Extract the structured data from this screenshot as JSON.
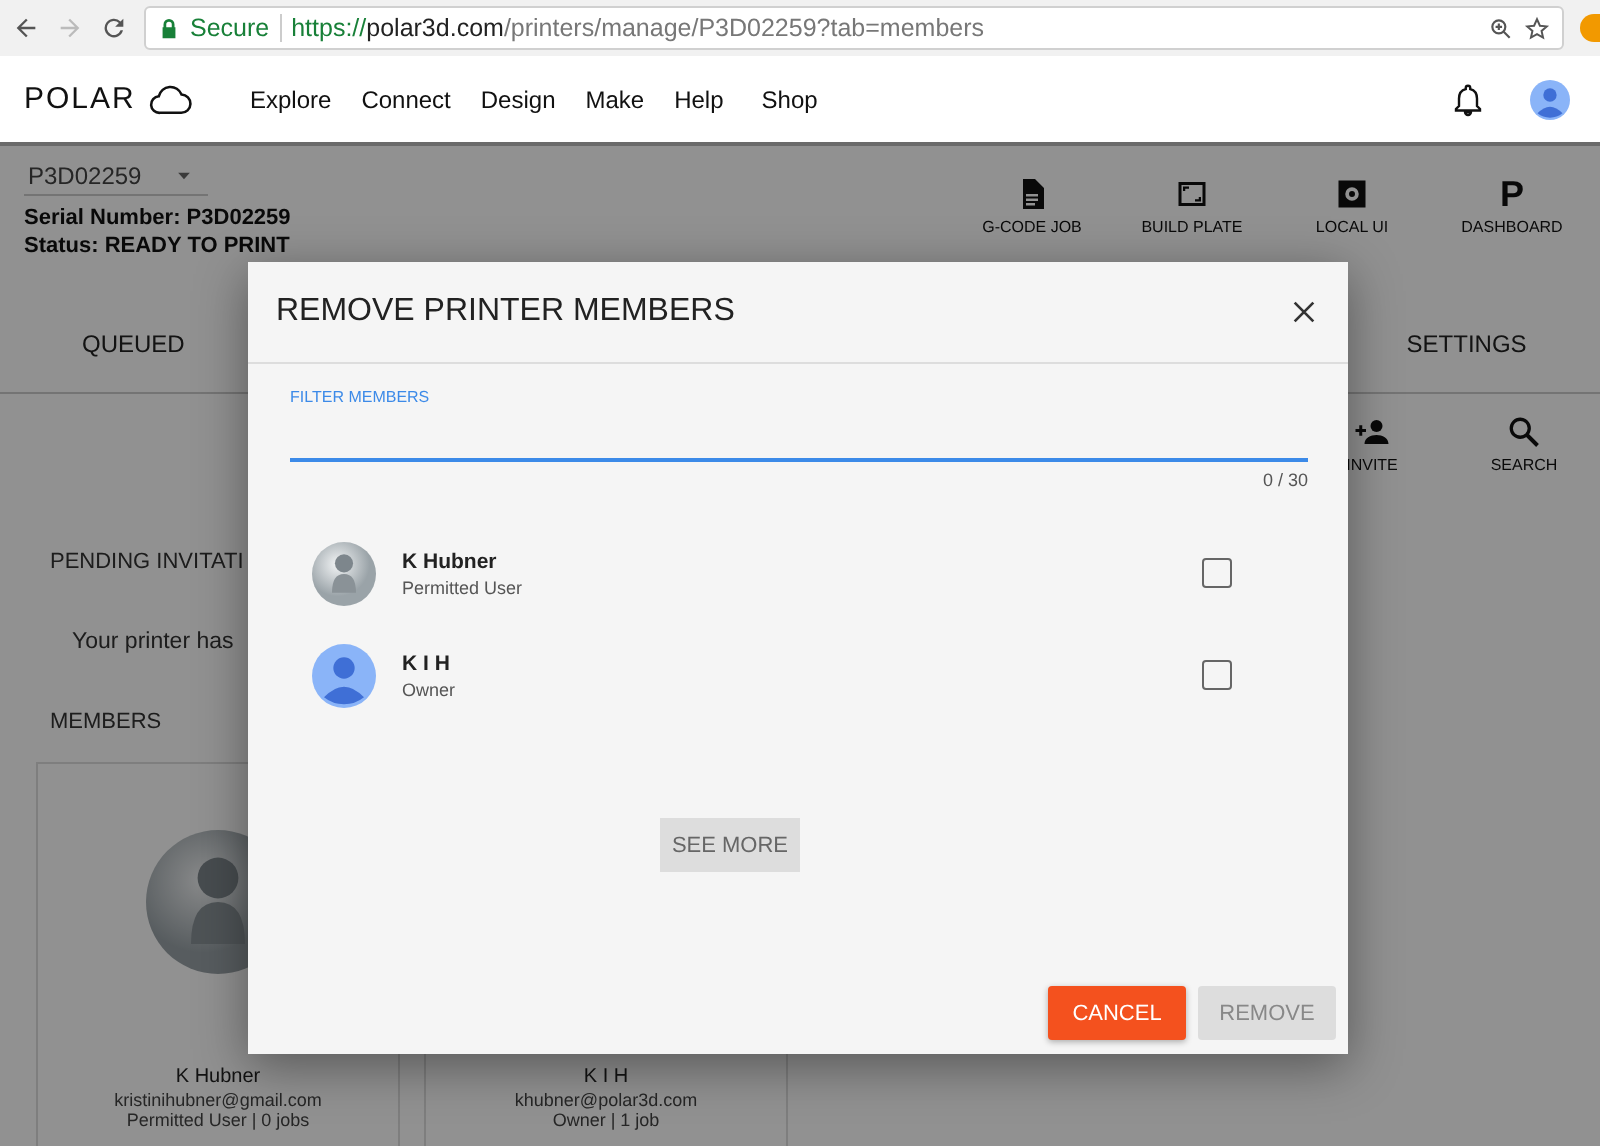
{
  "browser": {
    "security": "Secure",
    "url": {
      "scheme": "https://",
      "host": "polar3d.com",
      "path": "/printers/manage/P3D02259?tab=members"
    }
  },
  "nav": {
    "logo": "POLAR",
    "links": [
      "Explore",
      "Connect",
      "Design",
      "Make",
      "Help",
      "Shop"
    ]
  },
  "printer": {
    "selector": "P3D02259",
    "serial": "Serial Number: P3D02259",
    "status": "Status: READY TO PRINT"
  },
  "actions": [
    {
      "kind": "document",
      "label": "G-CODE JOB"
    },
    {
      "kind": "frame",
      "label": "BUILD PLATE"
    },
    {
      "kind": "chip",
      "label": "LOCAL UI"
    },
    {
      "kind": "letter",
      "glyph": "P",
      "label": "DASHBOARD"
    }
  ],
  "tabs": [
    {
      "label": "QUEUED"
    },
    {
      "label": "SETTINGS"
    }
  ],
  "toolbar": [
    {
      "kind": "invite",
      "label": "INVITE"
    },
    {
      "kind": "search",
      "label": "SEARCH"
    }
  ],
  "pending": {
    "heading": "PENDING INVITATI",
    "message": "Your printer has"
  },
  "members_heading": "MEMBERS",
  "cards": [
    {
      "kind": "legacy",
      "name": "K Hubner",
      "email": "kristinihubner@gmail.com",
      "info": "Permitted User | 0 jobs"
    },
    {
      "kind": "default",
      "name": "K I H",
      "email": "khubner@polar3d.com",
      "info": "Owner | 1 job"
    }
  ],
  "dialog": {
    "title": "REMOVE PRINTER MEMBERS",
    "filter": {
      "label": "FILTER MEMBERS",
      "counter": "0 / 30"
    },
    "members": [
      {
        "kind": "legacy",
        "name": "K Hubner",
        "role": "Permitted User",
        "checked": false
      },
      {
        "kind": "default",
        "name": "K I H",
        "role": "Owner",
        "checked": false
      }
    ],
    "see_more": "SEE MORE",
    "buttons": [
      {
        "label": "CANCEL",
        "disabled": false
      },
      {
        "label": "REMOVE",
        "disabled": true
      }
    ]
  }
}
